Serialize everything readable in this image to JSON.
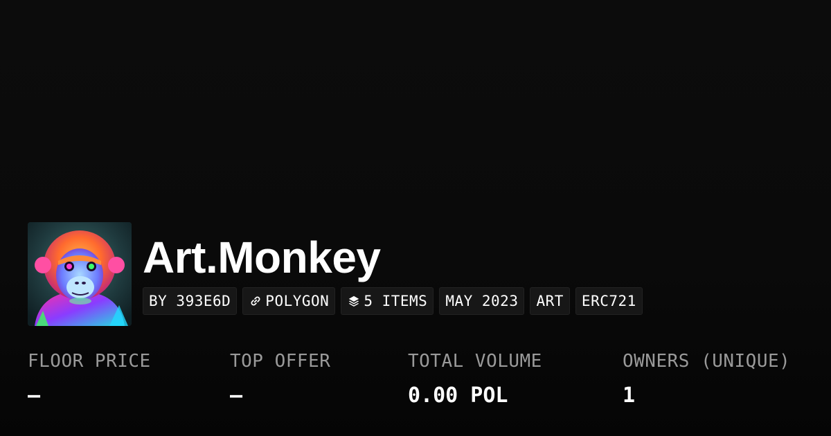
{
  "collection": {
    "name": "Art.Monkey",
    "avatar_alt": "Art.Monkey"
  },
  "tags": [
    {
      "label": "BY 393E6D",
      "icon": null
    },
    {
      "label": "POLYGON",
      "icon": "link-icon"
    },
    {
      "label": "5 ITEMS",
      "icon": "layers-icon"
    },
    {
      "label": "MAY 2023",
      "icon": null
    },
    {
      "label": "ART",
      "icon": null
    },
    {
      "label": "ERC721",
      "icon": null
    }
  ],
  "stats": {
    "floor_price": {
      "label": "FLOOR PRICE",
      "value": "–"
    },
    "top_offer": {
      "label": "TOP OFFER",
      "value": "–"
    },
    "total_volume": {
      "label": "TOTAL VOLUME",
      "value": "0.00 POL"
    },
    "owners": {
      "label": "OWNERS (UNIQUE)",
      "value": "1"
    }
  },
  "colors": {
    "background": "#0a0a0a",
    "tag_background": "#171717",
    "label_gray": "#9a9a9a",
    "text": "#ffffff"
  }
}
